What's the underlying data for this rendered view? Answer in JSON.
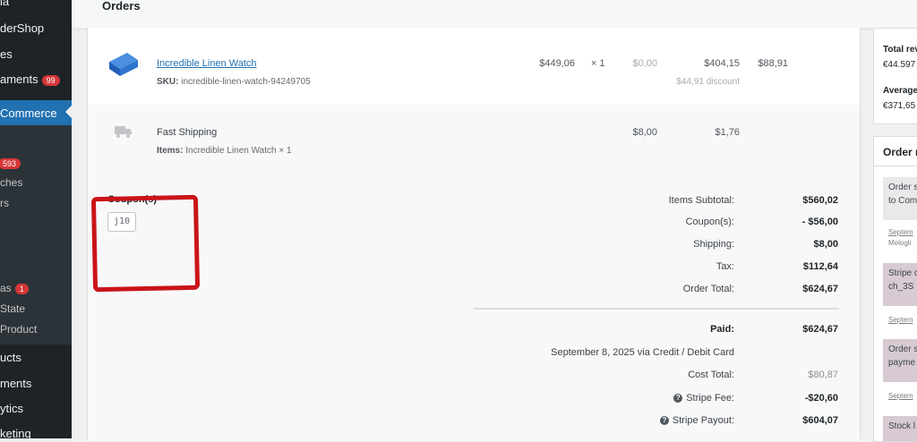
{
  "sidebar": {
    "items": [
      {
        "label": "ia"
      },
      {
        "label": "derShop"
      },
      {
        "label": "es"
      },
      {
        "label": "aments",
        "badge": "99"
      },
      {
        "label": "Commerce"
      },
      {
        "label": "",
        "badge": "593"
      },
      {
        "label": "ches"
      },
      {
        "label": "rs"
      },
      {
        "label": "as",
        "badge": "1"
      },
      {
        "label": "State"
      },
      {
        "label": "Product"
      },
      {
        "label": "ucts"
      },
      {
        "label": "ments"
      },
      {
        "label": "ytics"
      },
      {
        "label": "keting"
      }
    ]
  },
  "header": {
    "title": "Orders"
  },
  "order": {
    "item": {
      "name": "Incredible Linen Watch",
      "sku_label": "SKU:",
      "sku": "incredible-linen-watch-94249705",
      "cost": "$449,06",
      "qty": "× 1",
      "tax_zero": "$0,00",
      "total": "$404,15",
      "tax": "$88,91",
      "discount": "$44,91 discount"
    },
    "shipping": {
      "name": "Fast Shipping",
      "items_label": "Items:",
      "items": "Incredible Linen Watch × 1",
      "cost": "$8,00",
      "tax": "$1,76"
    },
    "coupons": {
      "title": "Coupon(s)",
      "code": "j10"
    },
    "totals": {
      "items_subtotal_label": "Items Subtotal:",
      "items_subtotal": "$560,02",
      "coupons_label": "Coupon(s):",
      "coupons": "- $56,00",
      "shipping_label": "Shipping:",
      "shipping": "$8,00",
      "tax_label": "Tax:",
      "tax": "$112,64",
      "order_total_label": "Order Total:",
      "order_total": "$624,67",
      "paid_label": "Paid:",
      "paid": "$624,67",
      "paid_note": "September 8, 2025 via Credit / Debit Card",
      "cost_total_label": "Cost Total:",
      "cost_total": "$80,87",
      "stripe_fee_label": "Stripe Fee:",
      "stripe_fee": "-$20,60",
      "stripe_payout_label": "Stripe Payout:",
      "stripe_payout": "$604,07"
    }
  },
  "right_panel": {
    "total_rev_label": "Total rev",
    "total_rev": "€44.597",
    "average_label": "Average",
    "average": "€371,65",
    "notes_title": "Order n",
    "notes": [
      {
        "line1": "Order s",
        "line2": "to Com",
        "meta": "Septem",
        "meta2": "Melogli",
        "purple": false
      },
      {
        "line1": "Stripe c",
        "line2": "ch_3S",
        "meta": "Septem",
        "meta2": "",
        "purple": true
      },
      {
        "line1": "Order s",
        "line2": "payme",
        "meta": "Septem",
        "meta2": "",
        "purple": true
      },
      {
        "line1": "Stock l",
        "line2": "",
        "meta": "",
        "meta2": "",
        "purple": true
      }
    ]
  }
}
